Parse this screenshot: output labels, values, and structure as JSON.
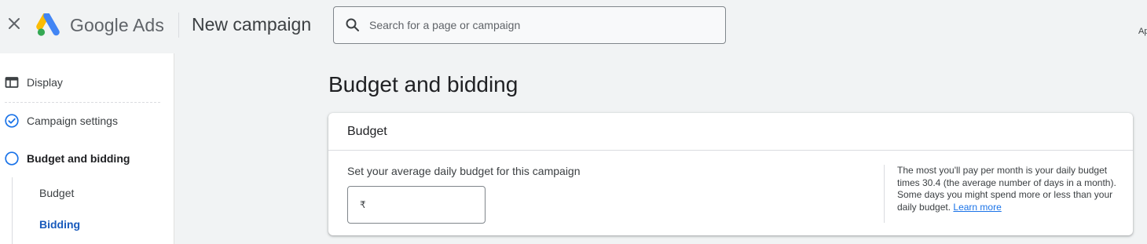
{
  "header": {
    "close_icon": "close-icon",
    "brand_name": "Google Ads",
    "page_title": "New campaign",
    "search": {
      "placeholder": "Search for a page or campaign",
      "value": ""
    },
    "corner_text": "Ap"
  },
  "sidebar": {
    "items": [
      {
        "label": "Display",
        "icon": "display-icon"
      },
      {
        "label": "Campaign settings",
        "icon": "check-circle-icon",
        "status": "complete"
      },
      {
        "label": "Budget and bidding",
        "icon": "circle-outline-icon",
        "status": "current"
      }
    ],
    "sub_items": [
      {
        "label": "Budget",
        "active": false
      },
      {
        "label": "Bidding",
        "active": true
      }
    ]
  },
  "main": {
    "title": "Budget and bidding",
    "budget_card": {
      "title": "Budget",
      "prompt": "Set your average daily budget for this campaign",
      "currency_symbol": "₹",
      "amount_value": "",
      "help_text": "The most you'll pay per month is your daily budget times 30.4 (the average number of days in a month). Some days you might spend more or less than your daily budget.",
      "learn_more": "Learn more"
    }
  },
  "colors": {
    "accent_blue": "#1a73e8",
    "selected_blue": "#185abc",
    "logo_blue": "#4285f4",
    "logo_yellow": "#fbbc04",
    "logo_green": "#34a853",
    "background": "#f1f3f4"
  }
}
